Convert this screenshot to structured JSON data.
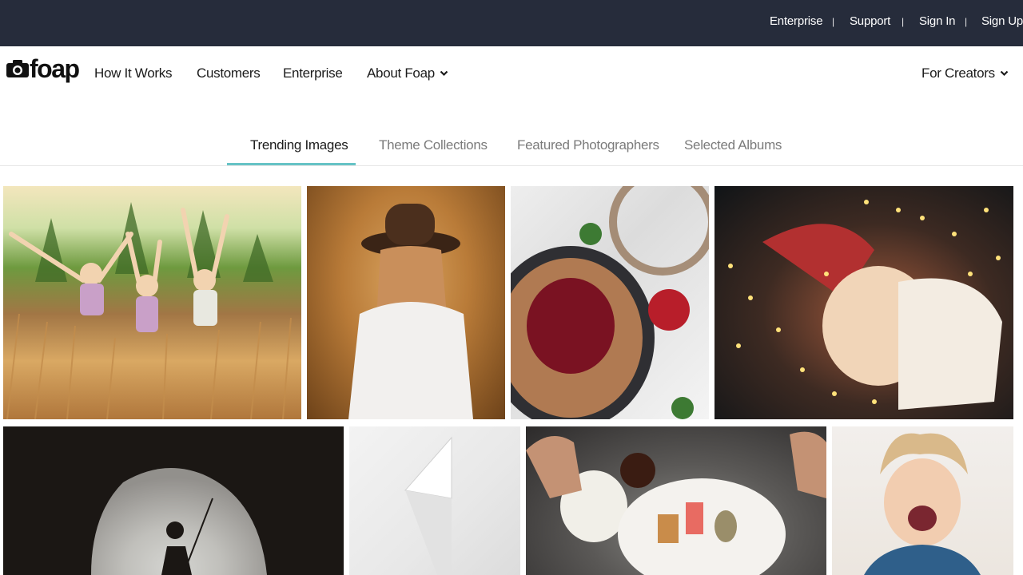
{
  "topbar": {
    "links": [
      {
        "label": "Enterprise"
      },
      {
        "label": "Support"
      },
      {
        "label": "Sign In"
      },
      {
        "label": "Sign Up"
      }
    ],
    "separator": "|"
  },
  "brand": {
    "name": "foap"
  },
  "nav": {
    "how_it_works": "How It Works",
    "customers": "Customers",
    "enterprise": "Enterprise",
    "about": "About Foap",
    "for_creators": "For Creators"
  },
  "tabs": [
    {
      "label": "Trending Images",
      "active": true
    },
    {
      "label": "Theme Collections",
      "active": false
    },
    {
      "label": "Featured Photographers",
      "active": false
    },
    {
      "label": "Selected Albums",
      "active": false
    }
  ],
  "colors": {
    "topbar_bg": "#262c3b",
    "tab_accent": "#66c3c6",
    "text_dark": "#1b1b1b",
    "text_muted": "#7b7b7b"
  },
  "icons": {
    "logo": "camera-icon",
    "dropdown": "chevron-down-icon"
  },
  "gallery": {
    "images": [
      {
        "subject": "children-in-wheat-field"
      },
      {
        "subject": "girl-with-hat-in-wheat-field"
      },
      {
        "subject": "holiday-pie-flatlay"
      },
      {
        "subject": "baby-with-christmas-lights"
      },
      {
        "subject": "climber-in-cave"
      },
      {
        "subject": "white-abstract-paper"
      },
      {
        "subject": "sushi-plate"
      },
      {
        "subject": "laughing-child"
      }
    ]
  }
}
